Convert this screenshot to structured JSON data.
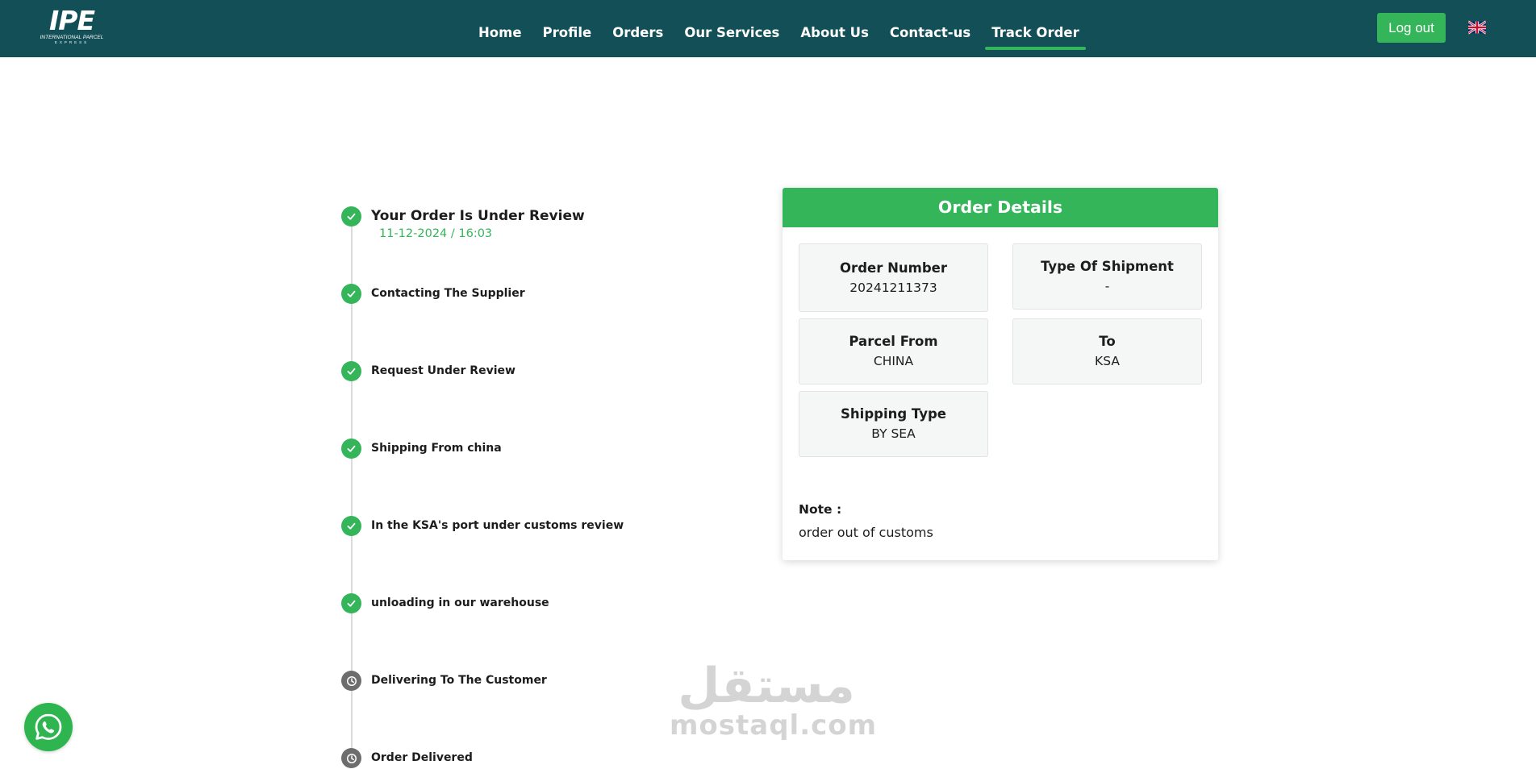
{
  "header": {
    "logo": {
      "mark": "IPE",
      "line1": "INTERNATIONAL PARCEL",
      "line2": "EXPRESS"
    },
    "nav": [
      {
        "label": "Home"
      },
      {
        "label": "Profile"
      },
      {
        "label": "Orders"
      },
      {
        "label": "Our Services"
      },
      {
        "label": "About Us"
      },
      {
        "label": "Contact-us"
      },
      {
        "label": "Track Order",
        "active": true
      }
    ],
    "logout_label": "Log out",
    "language_icon": "uk-flag-icon"
  },
  "timeline": {
    "steps": [
      {
        "title": "Your Order Is Under Review",
        "date": "11-12-2024 / 16:03",
        "status": "done"
      },
      {
        "title": "Contacting The Supplier",
        "status": "done"
      },
      {
        "title": "Request Under Review",
        "status": "done"
      },
      {
        "title": "Shipping From china",
        "status": "done"
      },
      {
        "title": "In the KSA's port under customs review",
        "status": "done"
      },
      {
        "title": "unloading in our warehouse",
        "status": "done"
      },
      {
        "title": "Delivering To The Customer",
        "status": "pending"
      },
      {
        "title": "Order Delivered",
        "status": "pending"
      }
    ]
  },
  "order_details": {
    "title": "Order Details",
    "order_number": {
      "label": "Order Number",
      "value": "20241211373"
    },
    "type_of_shipment": {
      "label": "Type Of Shipment",
      "value": "-"
    },
    "parcel_from": {
      "label": "Parcel From",
      "value": "CHINA"
    },
    "to": {
      "label": "To",
      "value": "KSA"
    },
    "shipping_type": {
      "label": "Shipping Type",
      "value": "BY SEA"
    },
    "note": {
      "label": "Note :",
      "value": "order out of customs"
    }
  },
  "watermark": {
    "arabic": "مستقل",
    "latin": "mostaql.com"
  },
  "colors": {
    "navbar": "#124f57",
    "accent": "#35b559",
    "pending": "#6d6d6d"
  }
}
